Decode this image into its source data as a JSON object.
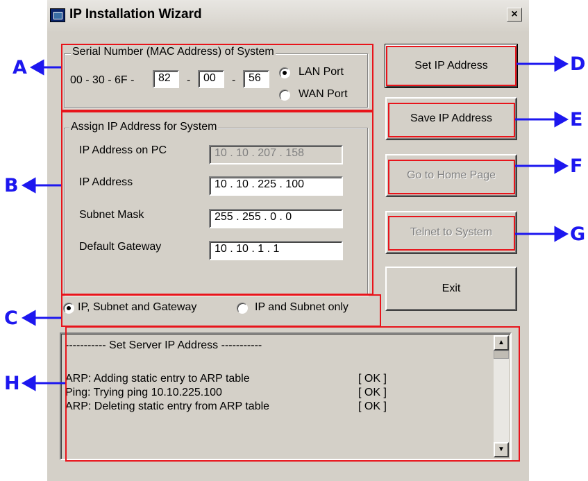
{
  "window": {
    "title": "IP Installation Wizard",
    "close_glyph": "×"
  },
  "serial": {
    "legend": "Serial Number (MAC Address) of System",
    "prefix": "00 - 30 - 6F -",
    "sep1": "-",
    "sep2": "-",
    "octet4": "82",
    "octet5": "00",
    "octet6": "56",
    "port_options": [
      {
        "label": "LAN Port",
        "selected": true
      },
      {
        "label": "WAN Port",
        "selected": false
      }
    ]
  },
  "assign": {
    "legend": "Assign IP Address for System",
    "rows": [
      {
        "label": "IP Address on PC",
        "value": "10 . 10 . 207 . 158",
        "enabled": false
      },
      {
        "label": "IP Address",
        "value": "10 . 10 . 225 . 100",
        "enabled": true
      },
      {
        "label": "Subnet Mask",
        "value": "255 . 255 .  0  .  0",
        "enabled": true
      },
      {
        "label": "Default Gateway",
        "value": "10 . 10 .  1  .  1",
        "enabled": true
      }
    ]
  },
  "mode": {
    "options": [
      {
        "label": "IP, Subnet and Gateway",
        "selected": true
      },
      {
        "label": "IP and Subnet only",
        "selected": false
      }
    ]
  },
  "buttons": {
    "set_ip": "Set IP Address",
    "save_ip": "Save IP Address",
    "home_page": "Go to Home Page",
    "telnet": "Telnet to System",
    "exit": "Exit"
  },
  "log": {
    "header": "----------- Set Server IP Address -----------",
    "entries": [
      {
        "text": "ARP: Adding static entry to ARP table",
        "status": "[  OK  ]"
      },
      {
        "text": "Ping: Trying ping 10.10.225.100",
        "status": "[  OK  ]"
      },
      {
        "text": "ARP: Deleting static entry from ARP table",
        "status": "[  OK  ]"
      }
    ],
    "scroll_up_glyph": "▲",
    "scroll_down_glyph": "▼"
  },
  "callouts": {
    "a": "A",
    "b": "B",
    "c": "C",
    "d": "D",
    "e": "E",
    "f": "F",
    "g": "G",
    "h": "H"
  },
  "colors": {
    "callout_blue": "#1d17ef",
    "highlight_red": "#e8141b",
    "window_gray": "#d4d0c8"
  }
}
